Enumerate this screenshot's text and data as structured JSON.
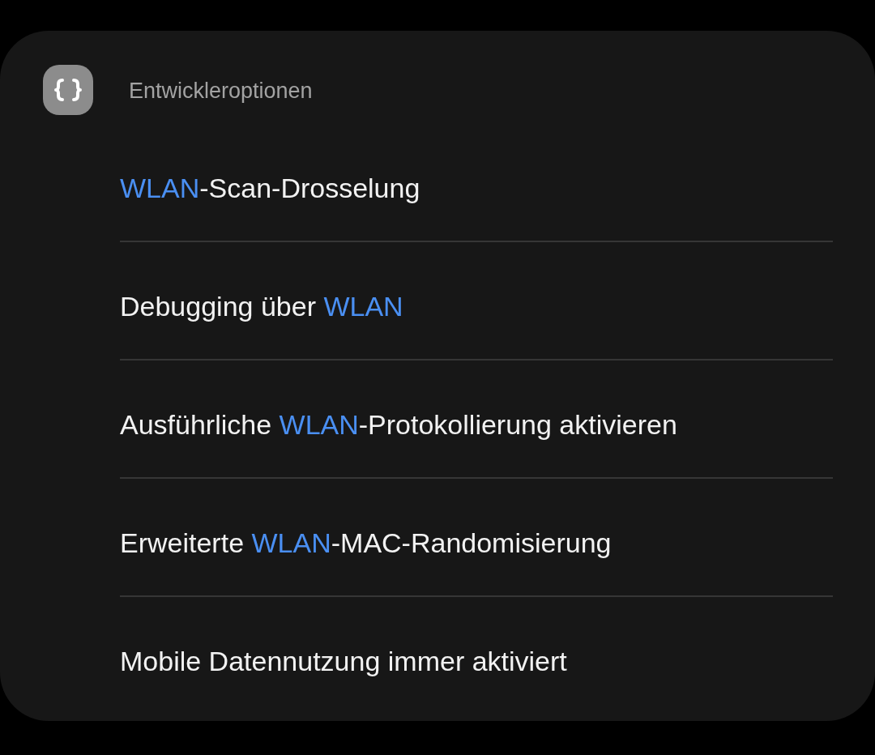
{
  "section": {
    "title": "Entwickleroptionen"
  },
  "items": [
    {
      "segments": [
        {
          "text": "WLAN",
          "highlighted": true
        },
        {
          "text": "-Scan-Drosselung",
          "highlighted": false
        }
      ]
    },
    {
      "segments": [
        {
          "text": "Debugging über ",
          "highlighted": false
        },
        {
          "text": "WLAN",
          "highlighted": true
        }
      ]
    },
    {
      "segments": [
        {
          "text": "Ausführliche ",
          "highlighted": false
        },
        {
          "text": "WLAN",
          "highlighted": true
        },
        {
          "text": "-Protokollierung aktivieren",
          "highlighted": false
        }
      ]
    },
    {
      "segments": [
        {
          "text": "Erweiterte ",
          "highlighted": false
        },
        {
          "text": "WLAN",
          "highlighted": true
        },
        {
          "text": "-MAC-Randomisierung",
          "highlighted": false
        }
      ]
    },
    {
      "segments": [
        {
          "text": "Mobile Datennutzung immer aktiviert",
          "highlighted": false
        }
      ]
    }
  ]
}
